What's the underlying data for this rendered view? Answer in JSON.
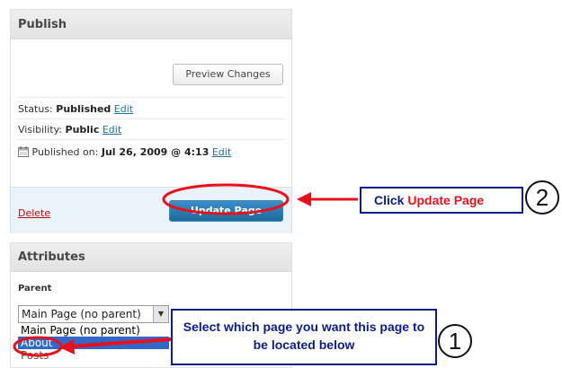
{
  "publish": {
    "title": "Publish",
    "preview_label": "Preview Changes",
    "status_label": "Status:",
    "status_value": "Published",
    "visibility_label": "Visibility:",
    "visibility_value": "Public",
    "published_label": "Published on:",
    "published_value": "Jul 26, 2009 @ 4:13",
    "edit_label": "Edit",
    "delete_label": "Delete",
    "update_label": "Update Page"
  },
  "attributes": {
    "title": "Attributes",
    "parent_label": "Parent",
    "selected": "Main Page (no parent)",
    "options": [
      "Main Page (no parent)",
      "About",
      "Posts"
    ]
  },
  "callouts": {
    "step2_prefix": "Click ",
    "step2_highlight": "Update Page",
    "step2_number": "2",
    "step1_text": "Select which page you want this page to be located below",
    "step1_number": "1"
  },
  "colors": {
    "annotation_red": "#e8101a",
    "annotation_blue": "#0b1c8c",
    "link": "#21759b"
  },
  "icons": {
    "calendar": "calendar-icon",
    "dropdown": "chevron-down-icon"
  }
}
